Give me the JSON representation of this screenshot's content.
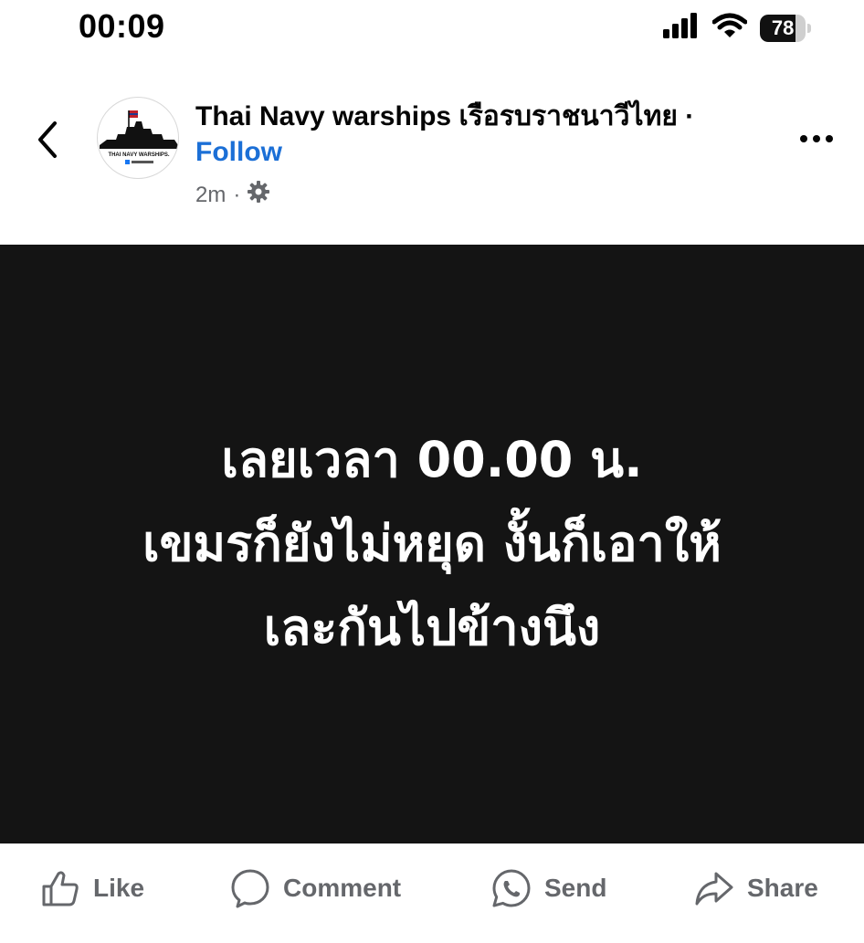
{
  "status_bar": {
    "time": "00:09",
    "battery_level": "78",
    "battery_fraction": 0.78,
    "icons": [
      "cellular-signal-icon",
      "wifi-icon",
      "battery-icon"
    ]
  },
  "post": {
    "page_name": "Thai Navy warships เรือรบราชนาวีไทย",
    "separator": "·",
    "follow_label": "Follow",
    "time_ago": "2m",
    "meta_dot": "·",
    "audience_icon": "gear-icon",
    "avatar_text": "THAI NAVY WARSHIPS.",
    "body_lines": [
      "เลยเวลา 00.00 น.",
      "เขมรก็ยังไม่หยุด งั้นก็เอาให้",
      "เละกันไปข้างนึง"
    ],
    "image_background": "#141414"
  },
  "actions": {
    "like_label": "Like",
    "comment_label": "Comment",
    "send_label": "Send",
    "share_label": "Share"
  },
  "colors": {
    "link_blue": "#1b6fd6",
    "muted_gray": "#65676b"
  }
}
